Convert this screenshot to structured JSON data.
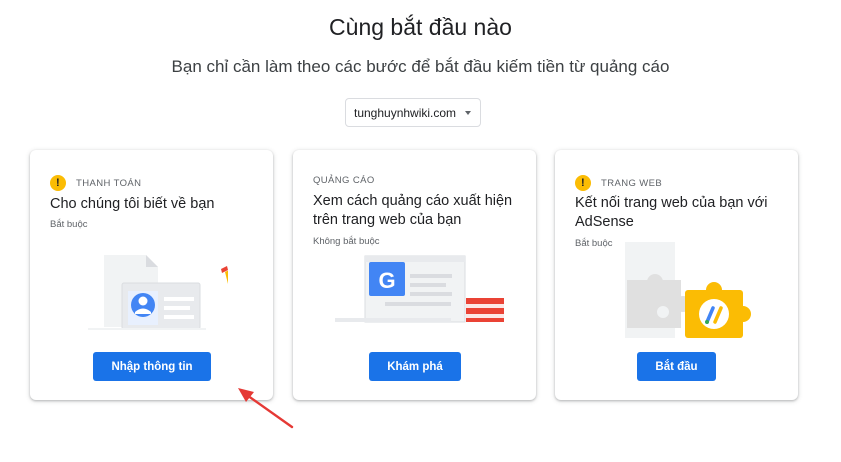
{
  "header": {
    "title": "Cùng bắt đầu nào",
    "subtitle": "Bạn chỉ cần làm theo các bước để bắt đầu kiếm tiền từ quảng cáo"
  },
  "site_select": {
    "value": "tunghuynhwiki.com"
  },
  "cards": [
    {
      "eyebrow": "THANH TOÁN",
      "title": "Cho chúng tôi biết về bạn",
      "meta": "Bắt buộc",
      "button": "Nhập thông tin"
    },
    {
      "eyebrow": "QUẢNG CÁO",
      "title": "Xem cách quảng cáo xuất hiện trên trang web của bạn",
      "meta": "Không bắt buộc",
      "button": "Khám phá",
      "logo_letter": "G"
    },
    {
      "eyebrow": "TRANG WEB",
      "title": "Kết nối trang web của bạn với AdSense",
      "meta": "Bắt buộc",
      "button": "Bắt đầu"
    }
  ],
  "warning_glyph": "!",
  "colors": {
    "primary": "#1a73e8",
    "warning": "#fbbc04",
    "arrow": "#e53935"
  }
}
